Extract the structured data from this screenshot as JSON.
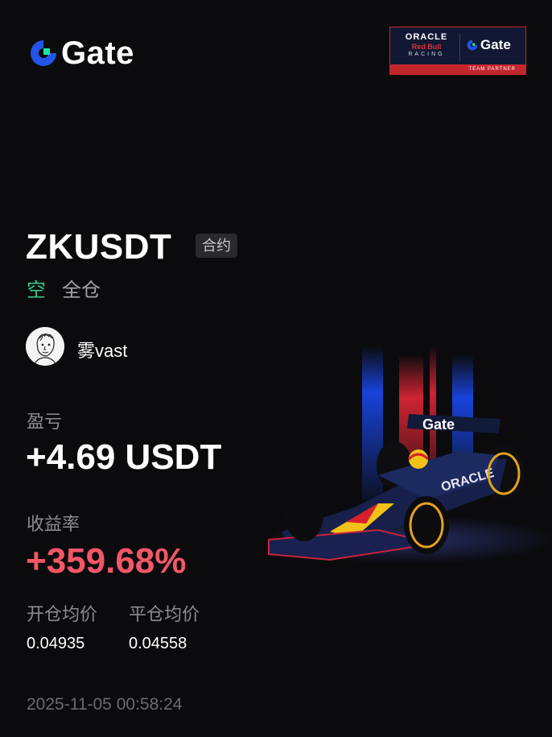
{
  "header": {
    "logo_text": "Gate",
    "partner_badge": {
      "oracle": "ORACLE",
      "red_bull": "Red Bull",
      "racing": "RACING",
      "gate_text": "Gate",
      "team_partner": "TEAM PARTNER"
    }
  },
  "position": {
    "pair": "ZKUSDT",
    "contract_badge": "合约",
    "side": "空",
    "margin_mode": "全仓"
  },
  "user": {
    "name": "雾vast"
  },
  "pnl": {
    "label": "盈亏",
    "value": "+4.69 USDT"
  },
  "roe": {
    "label": "收益率",
    "value": "+359.68%"
  },
  "prices": {
    "open_label": "开仓均价",
    "open_value": "0.04935",
    "close_label": "平仓均价",
    "close_value": "0.04558"
  },
  "timestamp": "2025-11-05 00:58:24",
  "colors": {
    "background": "#0b0b0d",
    "short_green": "#39c787",
    "profit_red": "#f35767",
    "brand_blue": "#2354e6",
    "brand_green": "#17e6a1"
  },
  "decor": {
    "car_livery_text": "Gate",
    "car_sidepod_text": "ORACLE"
  }
}
